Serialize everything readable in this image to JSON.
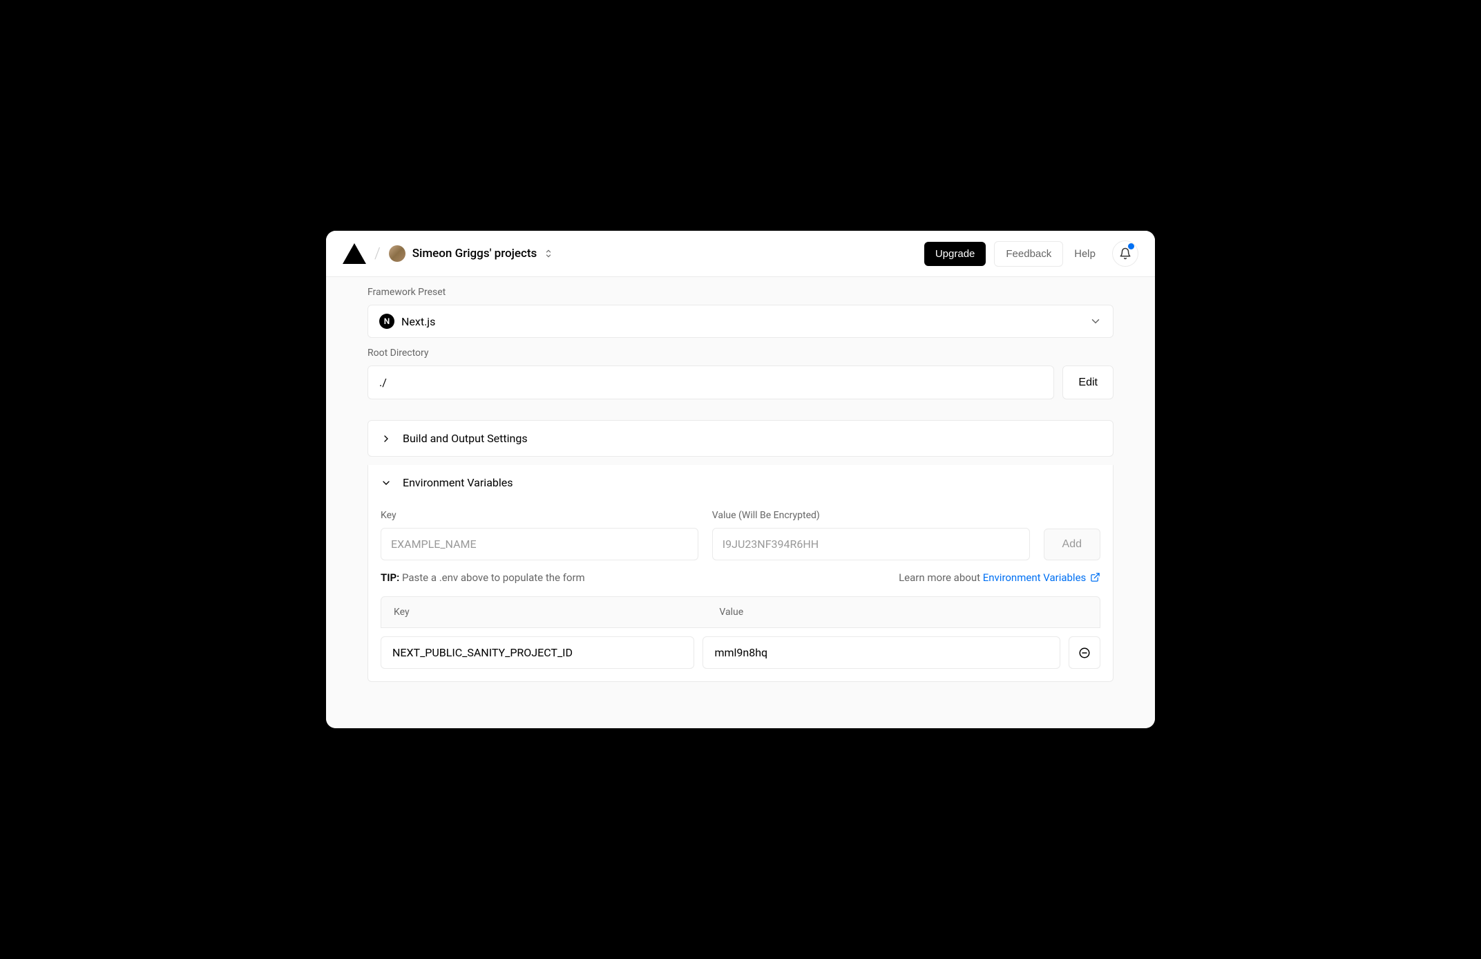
{
  "header": {
    "project_name": "Simeon Griggs' projects",
    "upgrade": "Upgrade",
    "feedback": "Feedback",
    "help": "Help"
  },
  "framework": {
    "label": "Framework Preset",
    "selected": "Next.js",
    "icon_letter": "N"
  },
  "root_dir": {
    "label": "Root Directory",
    "value": "./",
    "edit": "Edit"
  },
  "build_settings": {
    "title": "Build and Output Settings"
  },
  "env": {
    "title": "Environment Variables",
    "key_label": "Key",
    "value_label": "Value (Will Be Encrypted)",
    "key_placeholder": "EXAMPLE_NAME",
    "value_placeholder": "I9JU23NF394R6HH",
    "add": "Add",
    "tip_label": "TIP:",
    "tip_text": " Paste a .env above to populate the form",
    "learn_prefix": "Learn more about ",
    "learn_link": "Environment Variables",
    "table": {
      "key_header": "Key",
      "value_header": "Value"
    },
    "rows": [
      {
        "key": "NEXT_PUBLIC_SANITY_PROJECT_ID",
        "value": "mml9n8hq"
      }
    ]
  }
}
